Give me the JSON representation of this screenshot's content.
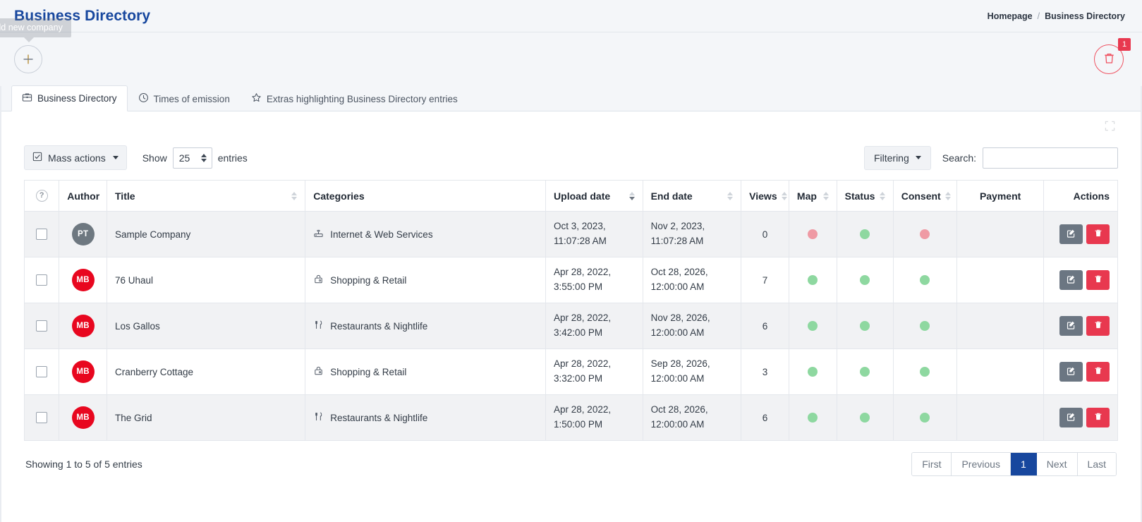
{
  "header": {
    "title": "Business Directory",
    "breadcrumb": [
      "Homepage",
      "Business Directory"
    ],
    "breadcrumb_separator": "/"
  },
  "toolbar": {
    "add_tooltip": "Add new company",
    "add_icon": "plus-icon",
    "trash_icon": "trash-icon",
    "trash_badge": "1"
  },
  "tabs": [
    {
      "label": "Business Directory",
      "icon": "briefcase-icon",
      "active": true
    },
    {
      "label": "Times of emission",
      "icon": "clock-icon",
      "active": false
    },
    {
      "label": "Extras highlighting Business Directory entries",
      "icon": "star-icon",
      "active": false
    }
  ],
  "panel": {
    "expand_icon": "fullscreen-icon"
  },
  "table_controls": {
    "mass_actions_label": "Mass actions",
    "mass_actions_icon": "checkbox-icon",
    "show_label": "Show",
    "entries_label": "entries",
    "page_length_value": "25",
    "filtering_label": "Filtering",
    "search_label": "Search:",
    "search_value": "",
    "search_placeholder": ""
  },
  "table": {
    "columns": [
      {
        "key": "select",
        "label": "",
        "icon": "question-circle-icon",
        "sortable": false,
        "align": "center"
      },
      {
        "key": "author",
        "label": "Author",
        "sortable": false,
        "align": "left"
      },
      {
        "key": "title",
        "label": "Title",
        "sortable": true,
        "sort": "none",
        "align": "left"
      },
      {
        "key": "categories",
        "label": "Categories",
        "sortable": false,
        "align": "left"
      },
      {
        "key": "upload",
        "label": "Upload date",
        "sortable": true,
        "sort": "desc",
        "align": "left"
      },
      {
        "key": "end",
        "label": "End date",
        "sortable": true,
        "sort": "none",
        "align": "left"
      },
      {
        "key": "views",
        "label": "Views",
        "sortable": true,
        "sort": "none",
        "align": "center"
      },
      {
        "key": "map",
        "label": "Map",
        "sortable": true,
        "sort": "none",
        "align": "center"
      },
      {
        "key": "status",
        "label": "Status",
        "sortable": true,
        "sort": "none",
        "align": "center"
      },
      {
        "key": "consent",
        "label": "Consent",
        "sortable": true,
        "sort": "none",
        "align": "center"
      },
      {
        "key": "payment",
        "label": "Payment",
        "sortable": false,
        "align": "center"
      },
      {
        "key": "actions",
        "label": "Actions",
        "sortable": false,
        "align": "right"
      }
    ],
    "rows": [
      {
        "selected": false,
        "author_initials": "PT",
        "author_color": "#6e7880",
        "title": "Sample Company",
        "category": "Internet & Web Services",
        "category_icon": "router-icon",
        "upload_date": "Oct 3, 2023,",
        "upload_time": "11:07:28 AM",
        "end_date": "Nov 2, 2023,",
        "end_time": "11:07:28 AM",
        "views": "0",
        "map": "red",
        "status": "green",
        "consent": "red",
        "payment": "",
        "edit_icon": "edit-icon",
        "delete_icon": "trash-icon"
      },
      {
        "selected": false,
        "author_initials": "MB",
        "author_color": "#e8071f",
        "title": "76 Uhaul",
        "category": "Shopping & Retail",
        "category_icon": "shopping-bag-icon",
        "upload_date": "Apr 28, 2022,",
        "upload_time": "3:55:00 PM",
        "end_date": "Oct 28, 2026,",
        "end_time": "12:00:00 AM",
        "views": "7",
        "map": "green",
        "status": "green",
        "consent": "green",
        "payment": "",
        "edit_icon": "edit-icon",
        "delete_icon": "trash-icon"
      },
      {
        "selected": false,
        "author_initials": "MB",
        "author_color": "#e8071f",
        "title": "Los Gallos",
        "category": "Restaurants & Nightlife",
        "category_icon": "cutlery-icon",
        "upload_date": "Apr 28, 2022,",
        "upload_time": "3:42:00 PM",
        "end_date": "Nov 28, 2026,",
        "end_time": "12:00:00 AM",
        "views": "6",
        "map": "green",
        "status": "green",
        "consent": "green",
        "payment": "",
        "edit_icon": "edit-icon",
        "delete_icon": "trash-icon"
      },
      {
        "selected": false,
        "author_initials": "MB",
        "author_color": "#e8071f",
        "title": "Cranberry Cottage",
        "category": "Shopping & Retail",
        "category_icon": "shopping-bag-icon",
        "upload_date": "Apr 28, 2022,",
        "upload_time": "3:32:00 PM",
        "end_date": "Sep 28, 2026,",
        "end_time": "12:00:00 AM",
        "views": "3",
        "map": "green",
        "status": "green",
        "consent": "green",
        "payment": "",
        "edit_icon": "edit-icon",
        "delete_icon": "trash-icon"
      },
      {
        "selected": false,
        "author_initials": "MB",
        "author_color": "#e8071f",
        "title": "The Grid",
        "category": "Restaurants & Nightlife",
        "category_icon": "cutlery-icon",
        "upload_date": "Apr 28, 2022,",
        "upload_time": "1:50:00 PM",
        "end_date": "Oct 28, 2026,",
        "end_time": "12:00:00 AM",
        "views": "6",
        "map": "green",
        "status": "green",
        "consent": "green",
        "payment": "",
        "edit_icon": "edit-icon",
        "delete_icon": "trash-icon"
      }
    ]
  },
  "footer": {
    "showing": "Showing 1 to 5 of 5 entries",
    "pagination": [
      {
        "label": "First",
        "active": false
      },
      {
        "label": "Previous",
        "active": false
      },
      {
        "label": "1",
        "active": true
      },
      {
        "label": "Next",
        "active": false
      },
      {
        "label": "Last",
        "active": false
      }
    ]
  },
  "colors": {
    "brand_blue": "#17479e",
    "danger_red": "#e8384f",
    "dot_green": "#8ed8a0",
    "dot_red": "#ef9aa4",
    "edit_gray": "#6b7682"
  }
}
